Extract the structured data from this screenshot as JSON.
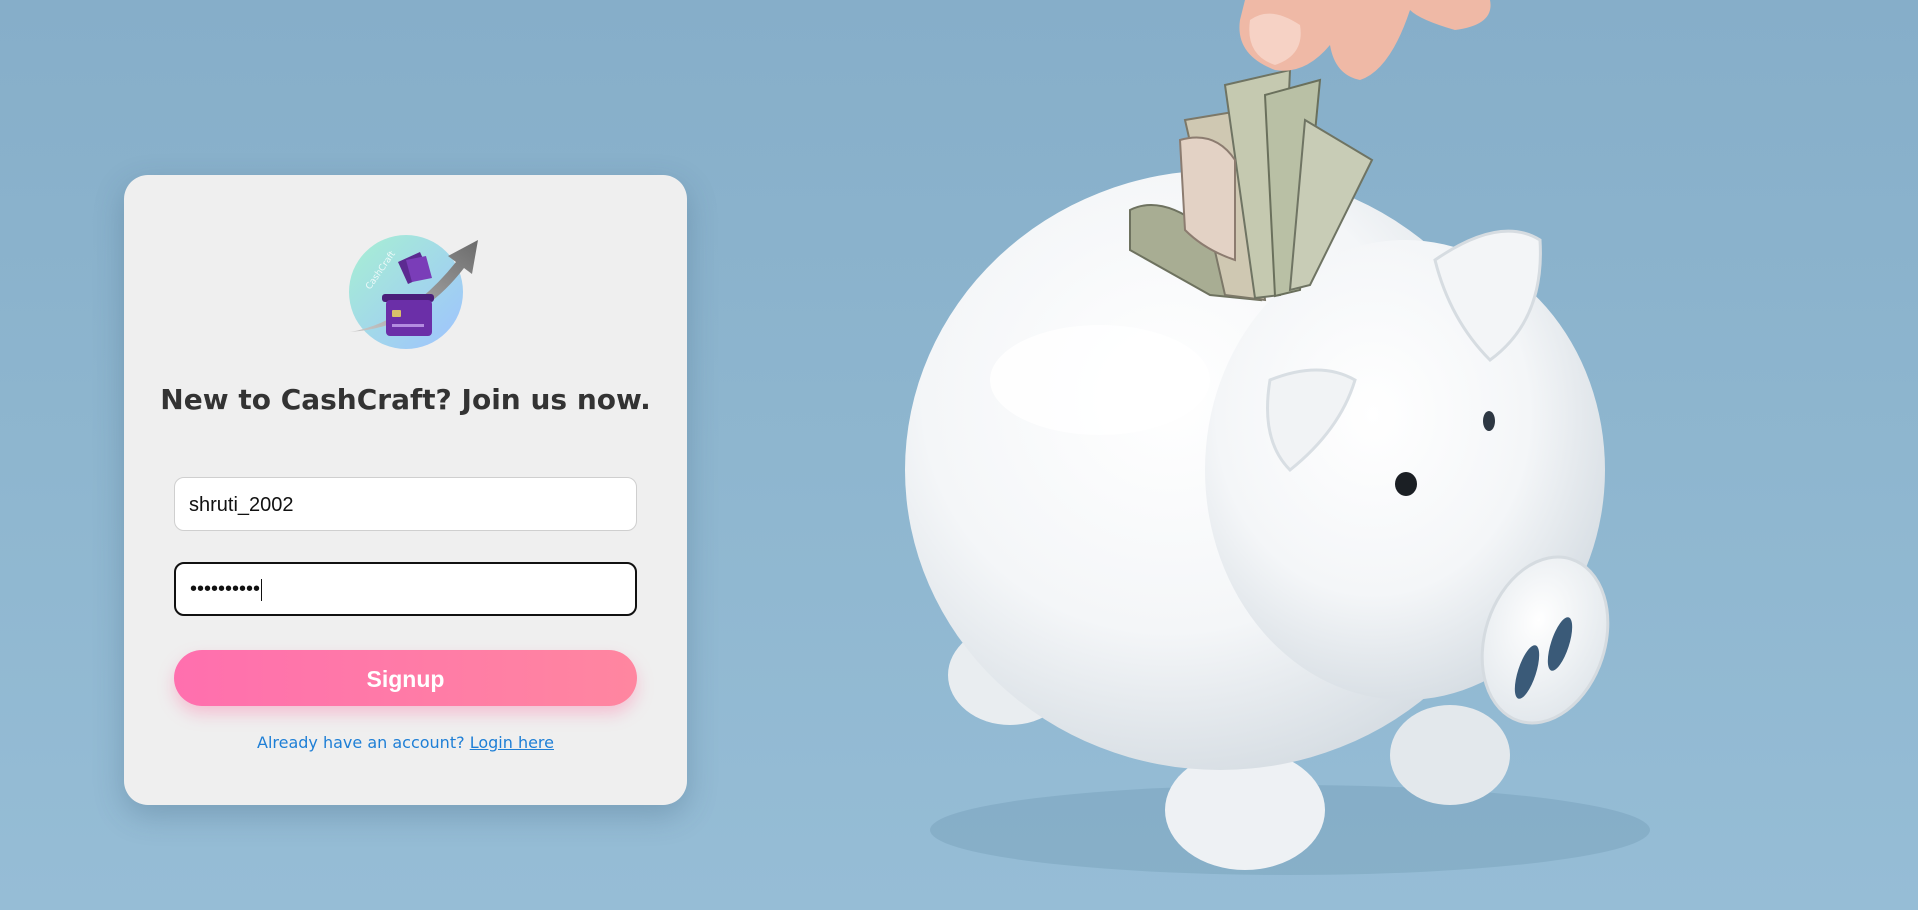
{
  "logo": {
    "icon": "cashcraft-logo",
    "text": "CashCraft"
  },
  "signup": {
    "heading": "New to CashCraft? Join us now.",
    "username_value": "shruti_2002",
    "password_value": "••••••••••",
    "button_label": "Signup",
    "login_prompt": "Already have an account?",
    "login_link": "Login here"
  },
  "background": {
    "description_icon": "piggy-bank-image"
  },
  "colors": {
    "background": "#8eb6cf",
    "card": "#efefef",
    "button_start": "#ff6fae",
    "button_end": "#ff86a0",
    "link": "#1e7fd6",
    "heading": "#333333"
  }
}
